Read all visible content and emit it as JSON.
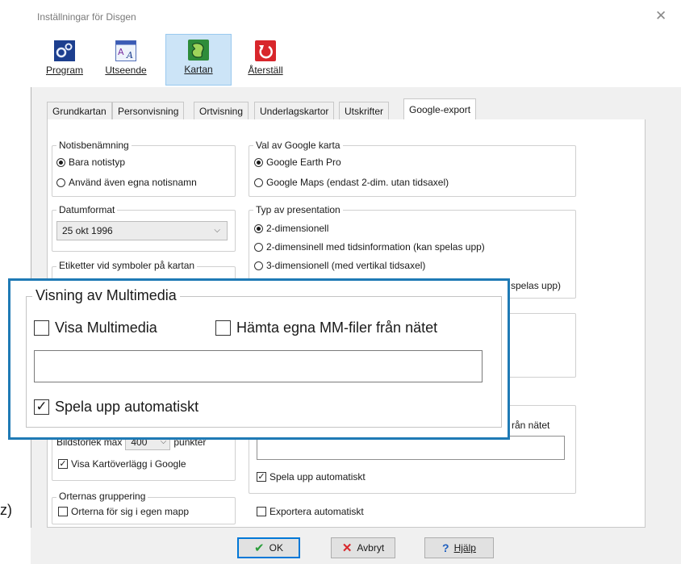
{
  "window": {
    "title": "Inställningar för Disgen",
    "close_glyph": "✕"
  },
  "toolbar": {
    "items": [
      {
        "label": "Program",
        "icon": "gear-icon",
        "selected": false
      },
      {
        "label": "Utseende",
        "icon": "font-style-icon",
        "selected": false
      },
      {
        "label": "Kartan",
        "icon": "map-icon",
        "selected": true
      },
      {
        "label": "Återställ",
        "icon": "reset-icon",
        "selected": false
      }
    ]
  },
  "tabs": [
    "Grundkartan",
    "Personvisning",
    "Ortvisning",
    "Underlagskartor",
    "Utskrifter",
    "Google-export"
  ],
  "active_tab": "Google-export",
  "notis": {
    "title": "Notisbenämning",
    "options": [
      "Bara notistyp",
      "Använd även egna notisnamn"
    ],
    "selected": 0
  },
  "datum": {
    "title": "Datumformat",
    "value": "25 okt 1996"
  },
  "etiketter": {
    "title": "Etiketter vid symboler på kartan"
  },
  "google_val": {
    "title": "Val av Google karta",
    "options": [
      "Google Earth Pro",
      "Google Maps (endast 2-dim. utan tidsaxel)"
    ],
    "selected": 0
  },
  "presentation": {
    "title": "Typ av presentation",
    "options": [
      "2-dimensionell",
      "2-dimensinell med tidsinformation (kan spelas upp)",
      "3-dimensionell (med vertikal tidsaxel)"
    ],
    "selected": 0,
    "partial_tail": "spelas upp)"
  },
  "bildstorlek": {
    "label": "Bildstorlek max",
    "value": "400",
    "unit": "punkter"
  },
  "kartoverlagg": {
    "label": "Visa Kartöverlägg i Google",
    "checked": true
  },
  "orter": {
    "title": "Orternas gruppering",
    "option": "Orterna för sig i egen mapp"
  },
  "multimedia_small": {
    "hamta_tail": "rån nätet",
    "spela": "Spela upp  automatiskt",
    "exportera": "Exportera automatiskt"
  },
  "callout": {
    "title": "Visning av  Multimedia",
    "visa": "Visa Multimedia",
    "hamta": "Hämta egna MM-filer från nätet",
    "spela": "Spela upp  automatiskt",
    "path_value": ""
  },
  "buttons": {
    "ok": "OK",
    "cancel": "Avbryt",
    "help": "Hjälp"
  },
  "side_fragment": "z)",
  "colors": {
    "accent": "#1f7ab5",
    "selected_bg": "#cce4f7"
  }
}
